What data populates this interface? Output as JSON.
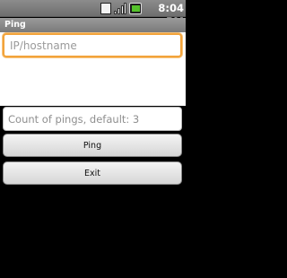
{
  "status_bar": {
    "time": "8:04 PM",
    "icons": [
      "sim-card-icon",
      "signal-icon",
      "battery-icon"
    ]
  },
  "app": {
    "title": "Ping"
  },
  "form": {
    "host_placeholder": "IP/hostname",
    "host_value": "",
    "count_placeholder": "Count of pings, default: 3",
    "count_value": "",
    "ping_label": "Ping",
    "exit_label": "Exit"
  },
  "colors": {
    "focus_border": "#f2a33a",
    "title_bar": "#8a8a8a",
    "background": "#000000"
  }
}
